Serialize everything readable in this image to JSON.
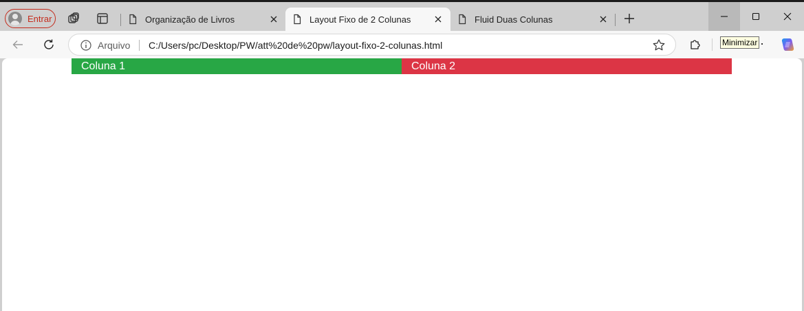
{
  "browser": {
    "profile_label": "Entrar",
    "tabs": [
      {
        "title": "Organização de Livros",
        "active": false
      },
      {
        "title": "Layout Fixo de 2 Colunas",
        "active": true
      },
      {
        "title": "Fluid Duas Colunas",
        "active": false
      }
    ],
    "address": {
      "security_label": "Arquivo",
      "url": "C:/Users/pc/Desktop/PW/att%20de%20pw/layout-fixo-2-colunas.html"
    },
    "tooltip": "Minimizar"
  },
  "page": {
    "column_1": {
      "label": "Coluna 1",
      "color": "#28a745"
    },
    "column_2": {
      "label": "Coluna 2",
      "color": "#dc3545"
    }
  },
  "colors": {
    "profile_accent": "#c42b1c",
    "tabstrip": "#cfcfcf",
    "toolbar": "#f7f7f7"
  }
}
